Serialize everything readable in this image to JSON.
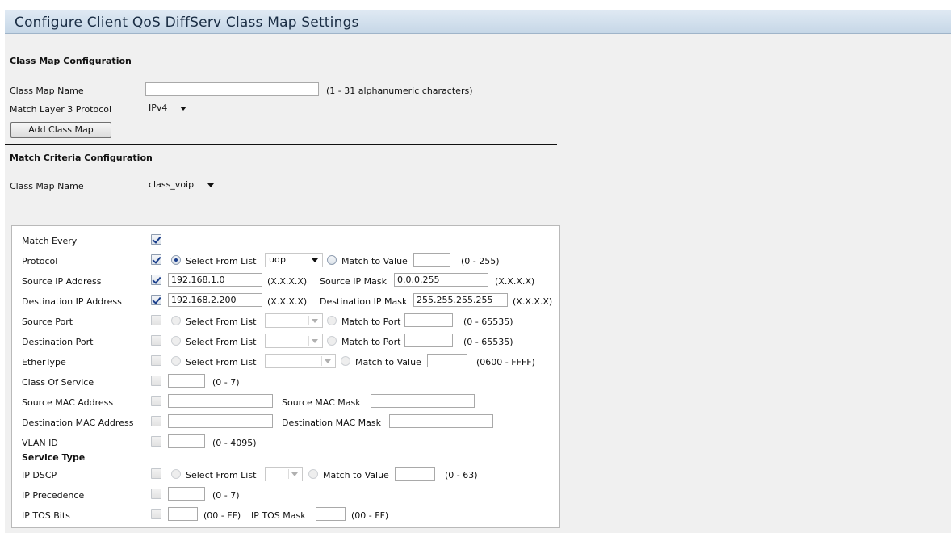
{
  "header": {
    "title": "Configure Client QoS DiffServ Class Map Settings"
  },
  "class_map_config": {
    "heading": "Class Map Configuration",
    "name_label": "Class Map Name",
    "name_value": "",
    "name_hint": "(1 - 31 alphanumeric characters)",
    "protocol_label": "Match Layer 3 Protocol",
    "protocol_value": "IPv4",
    "add_button": "Add Class Map"
  },
  "match_criteria": {
    "heading": "Match Criteria Configuration",
    "name_label": "Class Map Name",
    "name_value": "class_voip"
  },
  "rows": {
    "match_every": {
      "label": "Match Every",
      "checked": true
    },
    "protocol": {
      "label": "Protocol",
      "checked": true,
      "select_from_list": "Select From List",
      "list_value": "udp",
      "match_to_value": "Match to Value",
      "value": "",
      "range": "(0 - 255)"
    },
    "source_ip": {
      "label": "Source IP Address",
      "checked": true,
      "value": "192.168.1.0",
      "format": "(X.X.X.X)",
      "mask_label": "Source IP Mask",
      "mask_value": "0.0.0.255",
      "mask_format": "(X.X.X.X)"
    },
    "dest_ip": {
      "label": "Destination IP Address",
      "checked": true,
      "value": "192.168.2.200",
      "format": "(X.X.X.X)",
      "mask_label": "Destination IP Mask",
      "mask_value": "255.255.255.255",
      "mask_format": "(X.X.X.X)"
    },
    "source_port": {
      "label": "Source Port",
      "checked": false,
      "select_from_list": "Select From List",
      "match_to_port": "Match to Port",
      "range": "(0 - 65535)"
    },
    "dest_port": {
      "label": "Destination Port",
      "checked": false,
      "select_from_list": "Select From List",
      "match_to_port": "Match to Port",
      "range": "(0 - 65535)"
    },
    "ethertype": {
      "label": "EtherType",
      "checked": false,
      "select_from_list": "Select From List",
      "match_to_value": "Match to Value",
      "range": "(0600 - FFFF)"
    },
    "cos": {
      "label": "Class Of Service",
      "checked": false,
      "range": "(0 - 7)"
    },
    "source_mac": {
      "label": "Source MAC Address",
      "checked": false,
      "mask_label": "Source MAC Mask"
    },
    "dest_mac": {
      "label": "Destination MAC Address",
      "checked": false,
      "mask_label": "Destination MAC Mask"
    },
    "vlan_id": {
      "label": "VLAN ID",
      "checked": false,
      "range": "(0 - 4095)"
    },
    "service_type_heading": "Service Type",
    "ip_dscp": {
      "label": "IP DSCP",
      "checked": false,
      "select_from_list": "Select From List",
      "match_to_value": "Match to Value",
      "range": "(0 - 63)"
    },
    "ip_precedence": {
      "label": "IP Precedence",
      "checked": false,
      "range": "(0 - 7)"
    },
    "ip_tos": {
      "label": "IP TOS Bits",
      "checked": false,
      "range": "(00 - FF)",
      "mask_label": "IP TOS Mask",
      "mask_range": "(00 - FF)"
    }
  },
  "icons": {
    "dropdown": "chevron-down-icon",
    "checkbox": "checkmark-icon",
    "radio": "radio-dot-icon"
  },
  "colors": {
    "header_bg": "#c6d7e7",
    "content_bg": "#f0f0f0",
    "check_color": "#1a3e8c"
  }
}
